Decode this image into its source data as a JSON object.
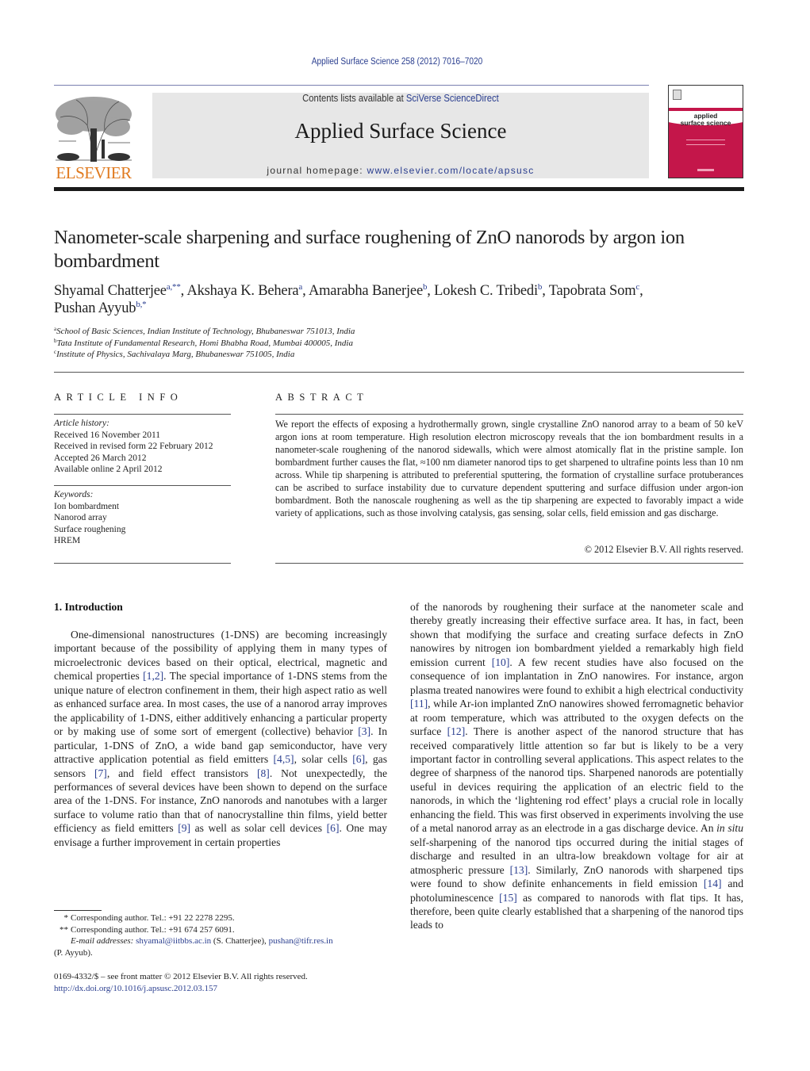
{
  "header": {
    "journal_ref": "Applied Surface Science 258 (2012) 7016–7020",
    "contents_prefix": "Contents lists available at ",
    "contents_link": "SciVerse ScienceDirect",
    "journal_name": "Applied Surface Science",
    "homepage_prefix": "journal homepage: ",
    "homepage_url": "www.elsevier.com/locate/apsusc",
    "publisher_logo_text": "ELSEVIER",
    "cover_title_line1": "applied",
    "cover_title_line2": "surface science"
  },
  "article": {
    "title": "Nanometer-scale sharpening and surface roughening of ZnO nanorods by argon ion bombardment",
    "authors": [
      {
        "name": "Shyamal Chatterjee",
        "sup": "a,**"
      },
      {
        "name": "Akshaya K. Behera",
        "sup": "a"
      },
      {
        "name": "Amarabha Banerjee",
        "sup": "b"
      },
      {
        "name": "Lokesh C. Tribedi",
        "sup": "b"
      },
      {
        "name": "Tapobrata Som",
        "sup": "c"
      },
      {
        "name": "Pushan Ayyub",
        "sup": "b,*"
      }
    ],
    "affiliations": [
      {
        "key": "a",
        "text": "School of Basic Sciences, Indian Institute of Technology, Bhubaneswar 751013, India"
      },
      {
        "key": "b",
        "text": "Tata Institute of Fundamental Research, Homi Bhabha Road, Mumbai 400005, India"
      },
      {
        "key": "c",
        "text": "Institute of Physics, Sachivalaya Marg, Bhubaneswar 751005, India"
      }
    ]
  },
  "article_info": {
    "heading": "ARTICLE INFO",
    "history_label": "Article history:",
    "history": [
      "Received 16 November 2011",
      "Received in revised form 22 February 2012",
      "Accepted 26 March 2012",
      "Available online 2 April 2012"
    ],
    "keywords_label": "Keywords:",
    "keywords": [
      "Ion bombardment",
      "Nanorod array",
      "Surface roughening",
      "HREM"
    ]
  },
  "abstract": {
    "heading": "ABSTRACT",
    "text": "We report the effects of exposing a hydrothermally grown, single crystalline ZnO nanorod array to a beam of 50 keV argon ions at room temperature. High resolution electron microscopy reveals that the ion bombardment results in a nanometer-scale roughening of the nanorod sidewalls, which were almost atomically flat in the pristine sample. Ion bombardment further causes the flat, ≈100 nm diameter nanorod tips to get sharpened to ultrafine points less than 10 nm across. While tip sharpening is attributed to preferential sputtering, the formation of crystalline surface protuberances can be ascribed to surface instability due to curvature dependent sputtering and surface diffusion under argon-ion bombardment. Both the nanoscale roughening as well as the tip sharpening are expected to favorably impact a wide variety of applications, such as those involving catalysis, gas sensing, solar cells, field emission and gas discharge.",
    "copyright": "© 2012 Elsevier B.V. All rights reserved."
  },
  "body": {
    "section_heading": "1.  Introduction",
    "left_column": [
      {
        "t": "One-dimensional nanostructures (1-DNS) are becoming increasingly important because of the possibility of applying them in many types of microelectronic devices based on their optical, electrical, magnetic and chemical properties "
      },
      {
        "c": "[1,2]"
      },
      {
        "t": ". The special importance of 1-DNS stems from the unique nature of electron confinement in them, their high aspect ratio as well as enhanced surface area. In most cases, the use of a nanorod array improves the applicability of 1-DNS, either additively enhancing a particular property or by making use of some sort of emergent (collective) behavior "
      },
      {
        "c": "[3]"
      },
      {
        "t": ". In particular, 1-DNS of ZnO, a wide band gap semiconductor, have very attractive application potential as field emitters "
      },
      {
        "c": "[4,5]"
      },
      {
        "t": ", solar cells "
      },
      {
        "c": "[6]"
      },
      {
        "t": ", gas sensors "
      },
      {
        "c": "[7]"
      },
      {
        "t": ", and field effect transistors "
      },
      {
        "c": "[8]"
      },
      {
        "t": ". Not unexpectedly, the performances of several devices have been shown to depend on the surface area of the 1-DNS. For instance, ZnO nanorods and nanotubes with a larger surface to volume ratio than that of nanocrystalline thin films, yield better efficiency as field emitters "
      },
      {
        "c": "[9]"
      },
      {
        "t": " as well as solar cell devices "
      },
      {
        "c": "[6]"
      },
      {
        "t": ". One may envisage a further improvement in certain properties"
      }
    ],
    "right_column": [
      {
        "t": "of the nanorods by roughening their surface at the nanometer scale and thereby greatly increasing their effective surface area. It has, in fact, been shown that modifying the surface and creating surface defects in ZnO nanowires by nitrogen ion bombardment yielded a remarkably high field emission current "
      },
      {
        "c": "[10]"
      },
      {
        "t": ". A few recent studies have also focused on the consequence of ion implantation in ZnO nanowires. For instance, argon plasma treated nanowires were found to exhibit a high electrical conductivity "
      },
      {
        "c": "[11]"
      },
      {
        "t": ", while Ar-ion implanted ZnO nanowires showed ferromagnetic behavior at room temperature, which was attributed to the oxygen defects on the surface "
      },
      {
        "c": "[12]"
      },
      {
        "t": ". There is another aspect of the nanorod structure that has received comparatively little attention so far but is likely to be a very important factor in controlling several applications. This aspect relates to the degree of sharpness of the nanorod tips. Sharpened nanorods are potentially useful in devices requiring the application of an electric field to the nanorods, in which the ‘lightening rod effect’ plays a crucial role in locally enhancing the field. This was first observed in experiments involving the use of a metal nanorod array as an electrode in a gas discharge device. An "
      },
      {
        "i": "in situ"
      },
      {
        "t": " self-sharpening of the nanorod tips occurred during the initial stages of discharge and resulted in an ultra-low breakdown voltage for air at atmospheric pressure "
      },
      {
        "c": "[13]"
      },
      {
        "t": ". Similarly, ZnO nanorods with sharpened tips were found to show definite enhancements in field emission "
      },
      {
        "c": "[14]"
      },
      {
        "t": " and photoluminescence "
      },
      {
        "c": "[15]"
      },
      {
        "t": " as compared to nanorods with flat tips. It has, therefore, been quite clearly established that a sharpening of the nanorod tips leads to"
      }
    ]
  },
  "footnotes": {
    "items": [
      {
        "mark": "*",
        "text": "Corresponding author. Tel.: +91 22 2278 2295."
      },
      {
        "mark": "**",
        "text": "Corresponding author. Tel.: +91 674 257 6091."
      }
    ],
    "email_label": "E-mail addresses:",
    "email1": "shyamal@iitbbs.ac.in",
    "email1_owner": " (S. Chatterjee), ",
    "email2": "pushan@tifr.res.in",
    "email2_owner": "(P. Ayyub).",
    "front_matter": "0169-4332/$ – see front matter © 2012 Elsevier B.V. All rights reserved.",
    "doi": "http://dx.doi.org/10.1016/j.apsusc.2012.03.157"
  },
  "colors": {
    "link": "#2a3e8f",
    "elsevier_orange": "#e07a1f",
    "cover_red": "#c4164a",
    "banner_gray": "#e7e7e7"
  }
}
